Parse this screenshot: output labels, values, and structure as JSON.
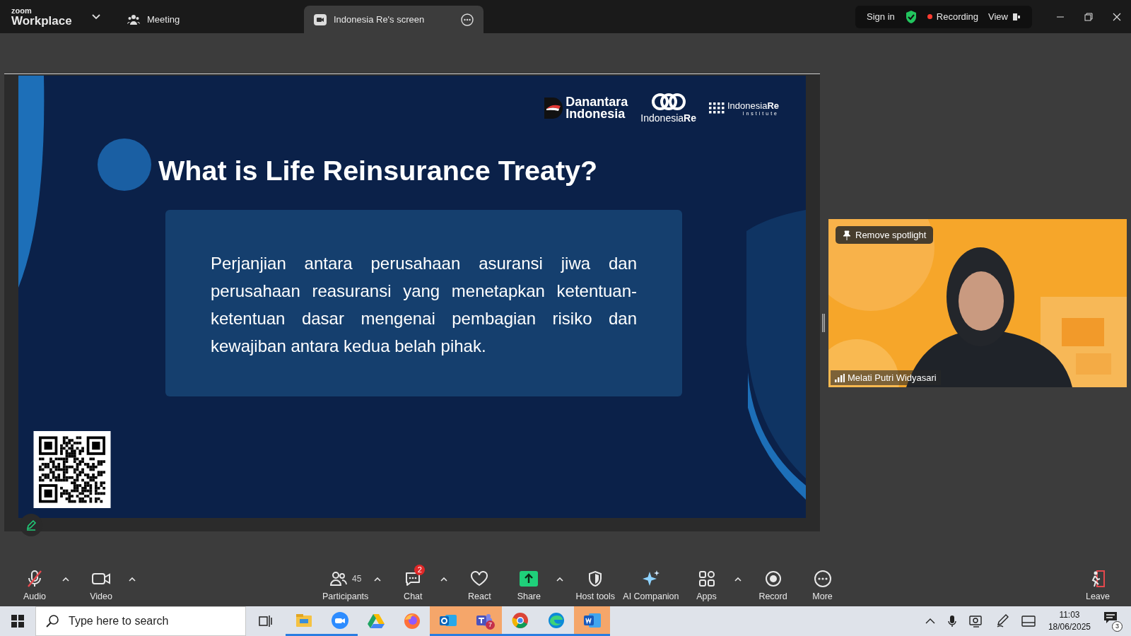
{
  "app": {
    "brand_small": "zoom",
    "brand": "Workplace"
  },
  "tabs": [
    {
      "label": "Meeting",
      "kind": "meeting",
      "selected": false
    },
    {
      "label": "Indonesia Re's screen",
      "kind": "share",
      "selected": true
    }
  ],
  "header": {
    "sign_in": "Sign in",
    "recording": "Recording",
    "view": "View"
  },
  "slide": {
    "logos": [
      {
        "kind": "danantara",
        "lines": [
          "Danantara",
          "Indonesia"
        ]
      },
      {
        "kind": "indonesiare",
        "lines": [
          "Indonesia",
          "Re"
        ]
      },
      {
        "kind": "institute",
        "lines": [
          "Indonesia",
          "Re",
          "Institute"
        ]
      }
    ],
    "title": "What is Life Reinsurance Treaty?",
    "body": "Perjanjian antara perusahaan asuransi jiwa dan perusahaan reasuransi yang menetapkan ketentuan-ketentuan dasar mengenai pembagian risiko dan kewajiban antara kedua belah pihak."
  },
  "video": {
    "spotlight": "Remove spotlight",
    "name": "Melati Putri Widyasari"
  },
  "toolbar": [
    {
      "kind": "audio",
      "label": "Audio",
      "caret": true,
      "muted": true
    },
    {
      "kind": "video",
      "label": "Video",
      "caret": true
    },
    {
      "kind": "participants",
      "label": "Participants",
      "count": "45",
      "caret": true
    },
    {
      "kind": "chat",
      "label": "Chat",
      "badge": "2",
      "caret": true
    },
    {
      "kind": "react",
      "label": "React",
      "caret": false
    },
    {
      "kind": "share",
      "label": "Share",
      "caret": true
    },
    {
      "kind": "host",
      "label": "Host tools",
      "caret": false
    },
    {
      "kind": "ai",
      "label": "AI Companion",
      "caret": false
    },
    {
      "kind": "apps",
      "label": "Apps",
      "caret": true
    },
    {
      "kind": "record",
      "label": "Record",
      "caret": false
    },
    {
      "kind": "more",
      "label": "More",
      "caret": false
    },
    {
      "kind": "leave",
      "label": "Leave",
      "caret": false
    }
  ],
  "taskbar": {
    "search": {
      "placeholder": "Type here to search"
    },
    "apps": [
      {
        "kind": "explorer",
        "running": true,
        "flashing": false
      },
      {
        "kind": "zoom",
        "running": true,
        "flashing": false
      },
      {
        "kind": "drive",
        "running": false,
        "flashing": false
      },
      {
        "kind": "firefox",
        "running": false,
        "flashing": false
      },
      {
        "kind": "outlook",
        "running": true,
        "flashing": true
      },
      {
        "kind": "teams",
        "running": true,
        "flashing": true,
        "badge": "7"
      },
      {
        "kind": "chrome",
        "running": true,
        "flashing": false
      },
      {
        "kind": "edge",
        "running": true,
        "flashing": false
      },
      {
        "kind": "word",
        "running": true,
        "flashing": true
      }
    ],
    "time": "11:03",
    "date": "18/06/2025",
    "notifications": "3"
  }
}
